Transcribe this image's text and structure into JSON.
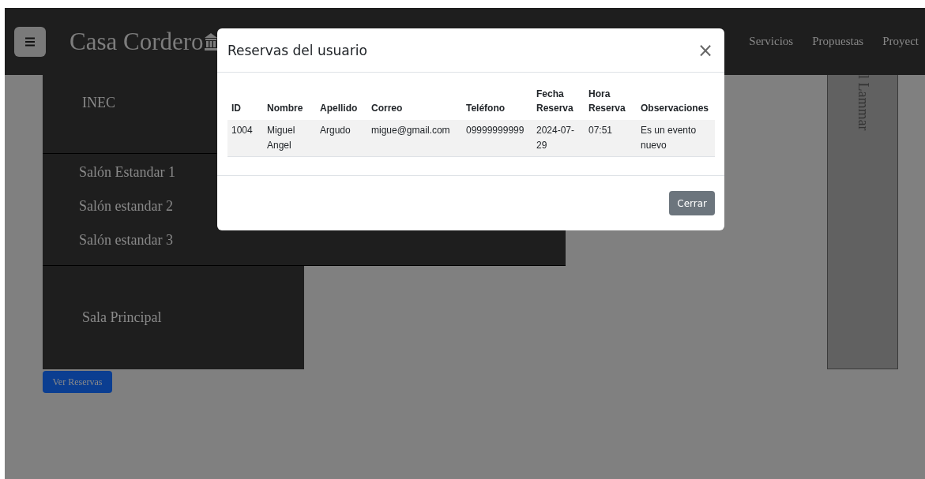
{
  "navbar": {
    "brand": "Casa Cordero",
    "links": [
      "Servicios",
      "Propuestas",
      "Proyect"
    ]
  },
  "floor_plan": {
    "top_room": "INEC",
    "salones": [
      "Salón Estandar 1",
      "Salón estandar 2",
      "Salón estandar 3"
    ],
    "main_room": "Sala Principal",
    "side_room": "l Lammar"
  },
  "view_button": "Ver Reservas",
  "modal": {
    "title": "Reservas del usuario",
    "close": "×",
    "columns": [
      "ID",
      "Nombre",
      "Apellido",
      "Correo",
      "Teléfono",
      "Fecha Reserva",
      "Hora Reserva",
      "Observaciones"
    ],
    "rows": [
      [
        "1004",
        "Miguel Angel",
        "Argudo",
        "migue@gmail.com",
        "09999999999",
        "2024-07-29",
        "07:51",
        "Es un evento nuevo"
      ]
    ],
    "button": "Cerrar"
  }
}
